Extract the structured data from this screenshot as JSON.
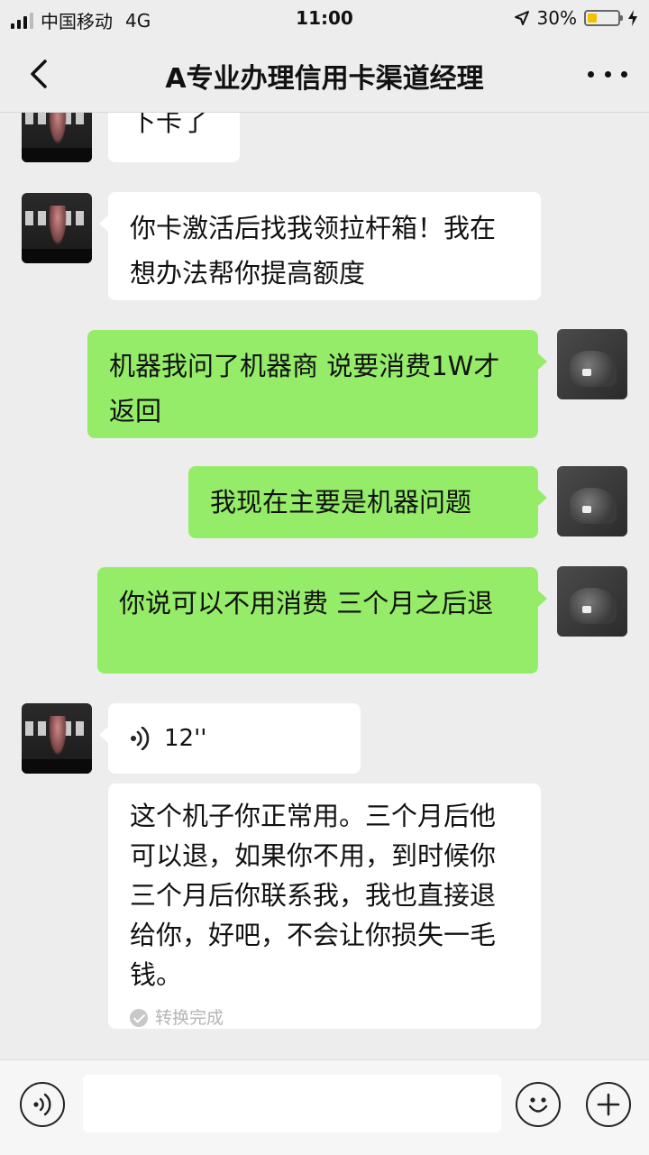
{
  "status_bar": {
    "carrier": "中国移动",
    "network": "4G",
    "time": "11:00",
    "battery_percent": "30%",
    "battery_level": 0.3,
    "battery_color": "#f2c200"
  },
  "nav": {
    "title": "A专业办理信用卡渠道经理",
    "back_icon": "chevron-left-icon",
    "more_icon": "more-dots-icon"
  },
  "messages": [
    {
      "from": "other",
      "text": "下卡了"
    },
    {
      "from": "other",
      "text": "你卡激活后找我领拉杆箱！我在想办法帮你提高额度"
    },
    {
      "from": "self",
      "text": "机器我问了机器商 说要消费1W才返回"
    },
    {
      "from": "self",
      "text": "我现在主要是机器问题"
    },
    {
      "from": "self",
      "text": "你说可以不用消费 三个月之后退"
    },
    {
      "from": "other",
      "type": "voice",
      "duration": "12''"
    },
    {
      "from": "other",
      "type": "transcription",
      "text": "这个机子你正常用。三个月后他可以退，如果你不用，到时候你三个月后你联系我，我也直接退给你，好吧，不会让你损失一毛钱。",
      "status": "转换完成"
    }
  ],
  "colors": {
    "self_bubble": "#95ec69",
    "other_bubble": "#ffffff",
    "background": "#ededed"
  },
  "input_bar": {
    "voice_icon": "voice-mode-icon",
    "emoji_icon": "emoji-icon",
    "plus_icon": "plus-icon",
    "text_value": ""
  }
}
